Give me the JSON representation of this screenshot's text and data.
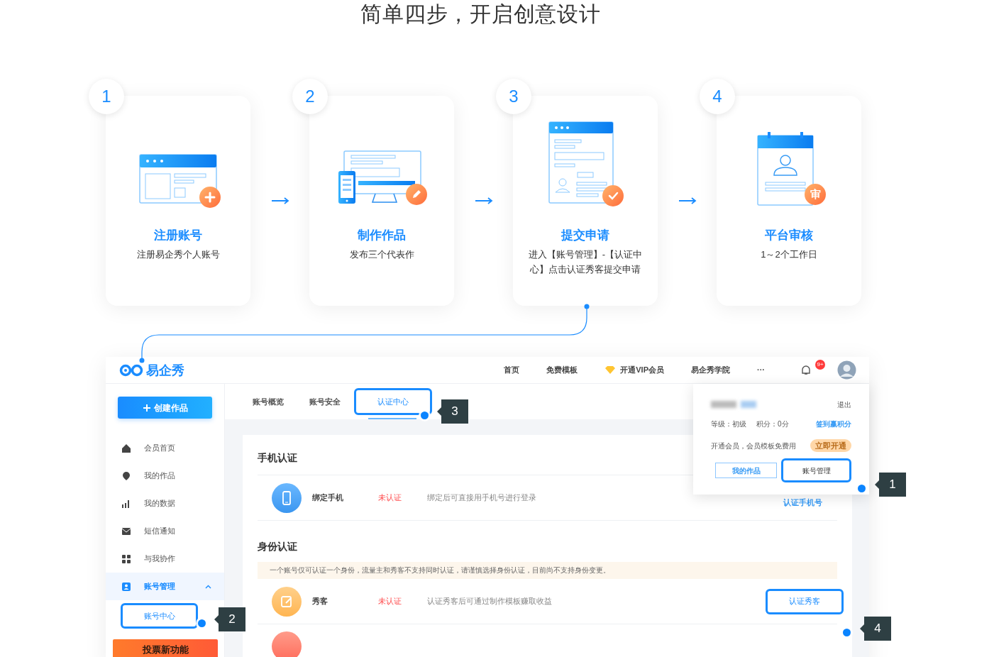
{
  "title": "简单四步，开启创意设计",
  "steps": [
    {
      "number": "1",
      "title": "注册账号",
      "description": "注册易企秀个人账号"
    },
    {
      "number": "2",
      "title": "制作作品",
      "description": "发布三个代表作"
    },
    {
      "number": "3",
      "title": "提交申请",
      "description": "进入【账号管理】-【认证中心】点击认证秀客提交申请"
    },
    {
      "number": "4",
      "title": "平台审核",
      "description": "1～2个工作日",
      "badge": "审"
    }
  ],
  "app": {
    "logo": "易企秀",
    "nav": [
      {
        "label": "首页",
        "kind": "link"
      },
      {
        "label": "免费模板",
        "kind": "link"
      },
      {
        "label": "开通VIP会员",
        "kind": "vip"
      },
      {
        "label": "易企秀学院",
        "kind": "link"
      },
      {
        "label": "···",
        "kind": "link"
      }
    ],
    "notification_count": "9+",
    "create_button": "创建作品",
    "sidebar": [
      {
        "label": "会员首页",
        "selected": false
      },
      {
        "label": "我的作品",
        "selected": false
      },
      {
        "label": "我的数据",
        "selected": false
      },
      {
        "label": "短信通知",
        "selected": false
      },
      {
        "label": "与我协作",
        "selected": false
      },
      {
        "label": "账号管理",
        "selected": true,
        "expanded": true,
        "children": [
          {
            "label": "账号中心",
            "selected": true,
            "highlighted": true
          }
        ]
      }
    ],
    "promo_banner": "投票新功能",
    "tabs": [
      {
        "label": "账号概览",
        "selected": false,
        "highlighted": false
      },
      {
        "label": "账号安全",
        "selected": false,
        "highlighted": false
      },
      {
        "label": "认证中心",
        "selected": true,
        "highlighted": true
      }
    ],
    "sections": [
      {
        "title": "手机认证",
        "rows": [
          {
            "name": "绑定手机",
            "status": "未认证",
            "description": "绑定后可直接用手机号进行登录",
            "action": "认证手机号",
            "kind": "link",
            "highlighted": false
          }
        ]
      },
      {
        "title": "身份认证",
        "notice": "一个账号仅可认证一个身份，流量主和秀客不支持同时认证，请谨慎选择身份认证，目前尚不支持身份变更。",
        "rows": [
          {
            "name": "秀客",
            "status": "未认证",
            "description": "认证秀客后可通过制作模板赚取收益",
            "action": "认证秀客",
            "kind": "button",
            "highlighted": true
          }
        ]
      }
    ],
    "user_menu": {
      "logout": "退出",
      "level": "等级：初级",
      "points": "积分：0分",
      "checkin": "签到赢积分",
      "promo": "开通会员，会员模板免费用",
      "promo_button": "立即开通",
      "buttons": [
        {
          "label": "我的作品",
          "highlighted": false
        },
        {
          "label": "账号管理",
          "highlighted": true
        }
      ]
    }
  },
  "callouts": [
    {
      "number": "1"
    },
    {
      "number": "2"
    },
    {
      "number": "3"
    },
    {
      "number": "4"
    }
  ]
}
